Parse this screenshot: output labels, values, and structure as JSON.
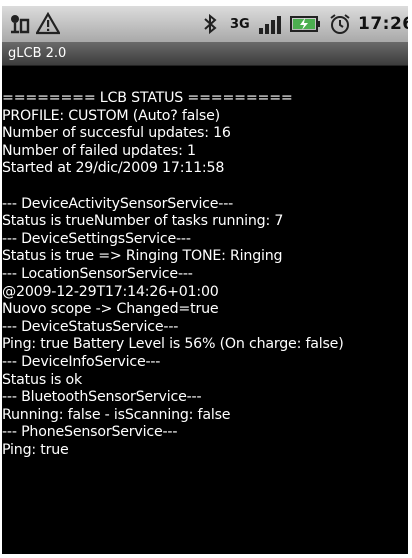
{
  "status_bar": {
    "time": "17:26",
    "network_label": "3G",
    "battery_color": "#4caf50",
    "icons": [
      "usb-icon",
      "warning-icon",
      "bluetooth-icon",
      "network-3g-icon",
      "signal-icon",
      "battery-charging-icon",
      "alarm-icon"
    ]
  },
  "app": {
    "title": "gLCB 2.0"
  },
  "status_lines": [
    "======== LCB STATUS =========",
    "PROFILE: CUSTOM (Auto? false)",
    "Number of succesful updates: 16",
    "Number of failed updates: 1",
    "Started at 29/dic/2009 17:11:58",
    "",
    "--- DeviceActivitySensorService---",
    "Status is trueNumber of tasks running: 7",
    "--- DeviceSettingsService---",
    "Status is true => Ringing TONE: Ringing",
    "--- LocationSensorService---",
    "@2009-12-29T17:14:26+01:00",
    "Nuovo scope -> Changed=true",
    "--- DeviceStatusService---",
    "Ping: true Battery Level is 56% (On charge: false)",
    "--- DeviceInfoService---",
    "Status is ok",
    "--- BluetoothSensorService---",
    "Running: false - isScanning: false",
    "--- PhoneSensorService---",
    "Ping: true"
  ]
}
